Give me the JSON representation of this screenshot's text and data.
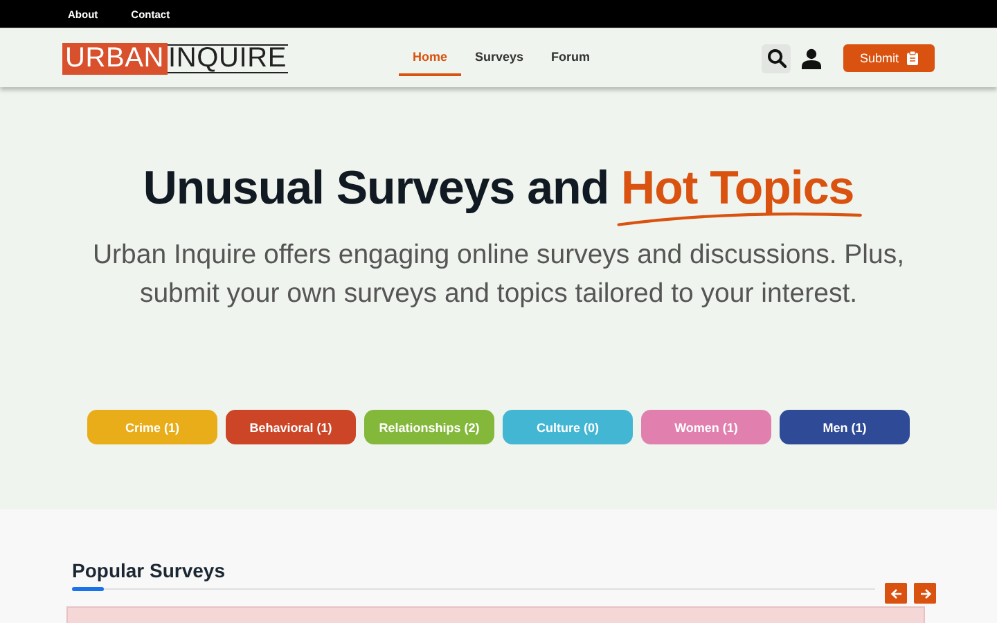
{
  "top_links": [
    "About",
    "Contact"
  ],
  "logo": {
    "part1": "URBAN",
    "part2": "INQUIRE"
  },
  "nav": [
    {
      "label": "Home",
      "selected": true
    },
    {
      "label": "Surveys",
      "selected": false
    },
    {
      "label": "Forum",
      "selected": false
    }
  ],
  "submit_button": "Submit",
  "hero": {
    "headline": "Unusual Surveys and ",
    "headline_highlight": "Hot Topics",
    "subtitle": "Urban Inquire offers engaging online surveys and discussions. Plus, submit your own surveys and topics tailored to your interest."
  },
  "categories": [
    {
      "label": "Crime (1)",
      "color": "#e9ad1a"
    },
    {
      "label": "Behavioral (1)",
      "color": "#cc4526"
    },
    {
      "label": "Relationships (2)",
      "color": "#84b83a"
    },
    {
      "label": "Culture (0)",
      "color": "#43b6d3"
    },
    {
      "label": "Women (1)",
      "color": "#e17fae"
    },
    {
      "label": "Men (1)",
      "color": "#2f4a96"
    }
  ],
  "popular": {
    "title": "Popular Surveys"
  }
}
